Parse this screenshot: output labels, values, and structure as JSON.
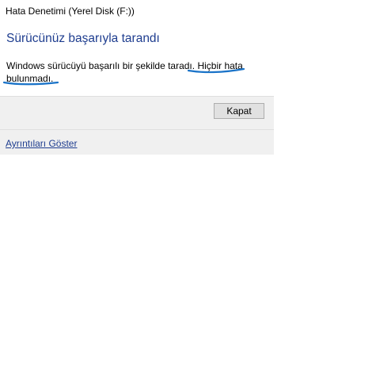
{
  "window": {
    "title": "Hata Denetimi (Yerel Disk (F:))"
  },
  "main": {
    "heading": "Sürücünüz başarıyla tarandı",
    "message_part1": "Windows sürücüyü başarılı bir şekilde taradı. ",
    "message_highlight_line1": "Hiçbir hata",
    "message_highlight_line2": "bulunmadı",
    "message_end": "."
  },
  "footer": {
    "close_label": "Kapat",
    "details_link": "Ayrıntıları Göster"
  },
  "colors": {
    "heading": "#1e3d8f",
    "annotation": "#1a73c8",
    "footer_bg": "#f0f0f0"
  }
}
